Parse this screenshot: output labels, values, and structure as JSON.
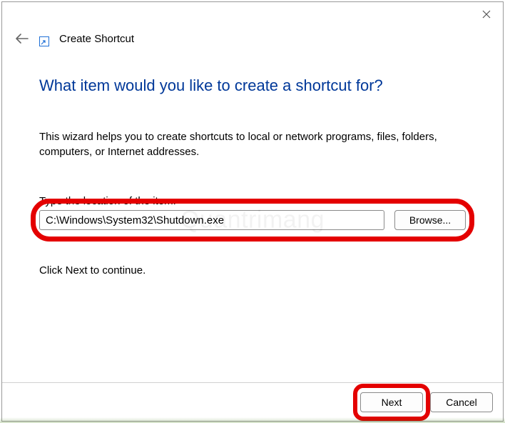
{
  "window": {
    "title": "Create Shortcut"
  },
  "heading": "What item would you like to create a shortcut for?",
  "description": "This wizard helps you to create shortcuts to local or network programs, files, folders, computers, or Internet addresses.",
  "location": {
    "label": "Type the location of the item:",
    "value": "C:\\Windows\\System32\\Shutdown.exe",
    "browse_label": "Browse..."
  },
  "continue_text": "Click Next to continue.",
  "footer": {
    "next_label": "Next",
    "cancel_label": "Cancel"
  },
  "watermark": "Quantrimang"
}
